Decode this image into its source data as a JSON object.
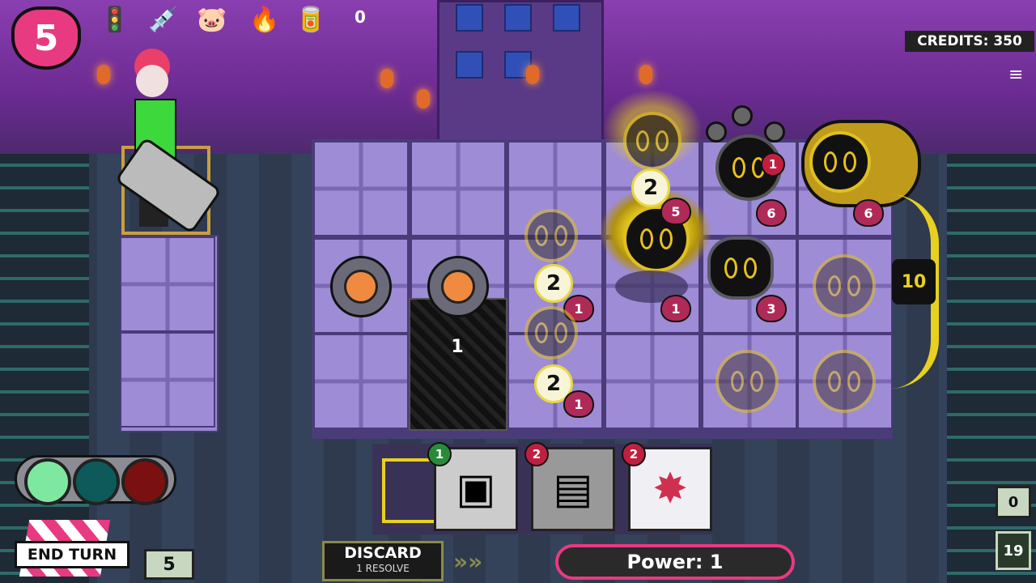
{
  "hud": {
    "health": "5",
    "item_count": "0",
    "credits": "CREDITS: 350",
    "items": [
      {
        "icon": "traffic-light-icon",
        "glyph": "🚦"
      },
      {
        "icon": "syringe-icon",
        "glyph": "💉"
      },
      {
        "icon": "piggy-bank-icon",
        "glyph": "🐷"
      },
      {
        "icon": "lighter-icon",
        "glyph": "🔥"
      },
      {
        "icon": "can-icon",
        "glyph": "🥫"
      }
    ]
  },
  "board": {
    "block_counter": "1",
    "boss_timer": "10",
    "enemies": [
      {
        "kind": "ghost-cat",
        "attack": "2",
        "health": "1"
      },
      {
        "kind": "ghost-cat",
        "attack": "2",
        "health": "1"
      },
      {
        "kind": "sun-spirit",
        "attack": "2",
        "health": "5"
      },
      {
        "kind": "sun-spirit-shadow",
        "health": "1"
      },
      {
        "kind": "eyestalk-bot",
        "attack": "1",
        "health": "6"
      },
      {
        "kind": "shadow-cat",
        "health": "3"
      },
      {
        "kind": "gold-boss",
        "health": "6"
      }
    ]
  },
  "hand": {
    "cards": [
      {
        "cost": "1",
        "cost_color": "#2a8a3a",
        "icon": "square-frame-icon"
      },
      {
        "cost": "2",
        "cost_color": "#c02040",
        "icon": "chip-icon"
      },
      {
        "cost": "2",
        "cost_color": "#c02040",
        "icon": "burst-icon"
      }
    ]
  },
  "controls": {
    "end_turn": "END TURN",
    "deck_count": "5",
    "discard": "DISCARD",
    "discard_sub": "1 RESOLVE",
    "power": "Power: 1",
    "discard_pile_count": "0",
    "draw_pile_count": "19"
  },
  "colors": {
    "light_green": "#7ee8a0",
    "light_teal": "#0e5a5a",
    "light_red": "#7a1010",
    "accent_yellow": "#e8d020",
    "heart_pink": "#e83a80"
  }
}
